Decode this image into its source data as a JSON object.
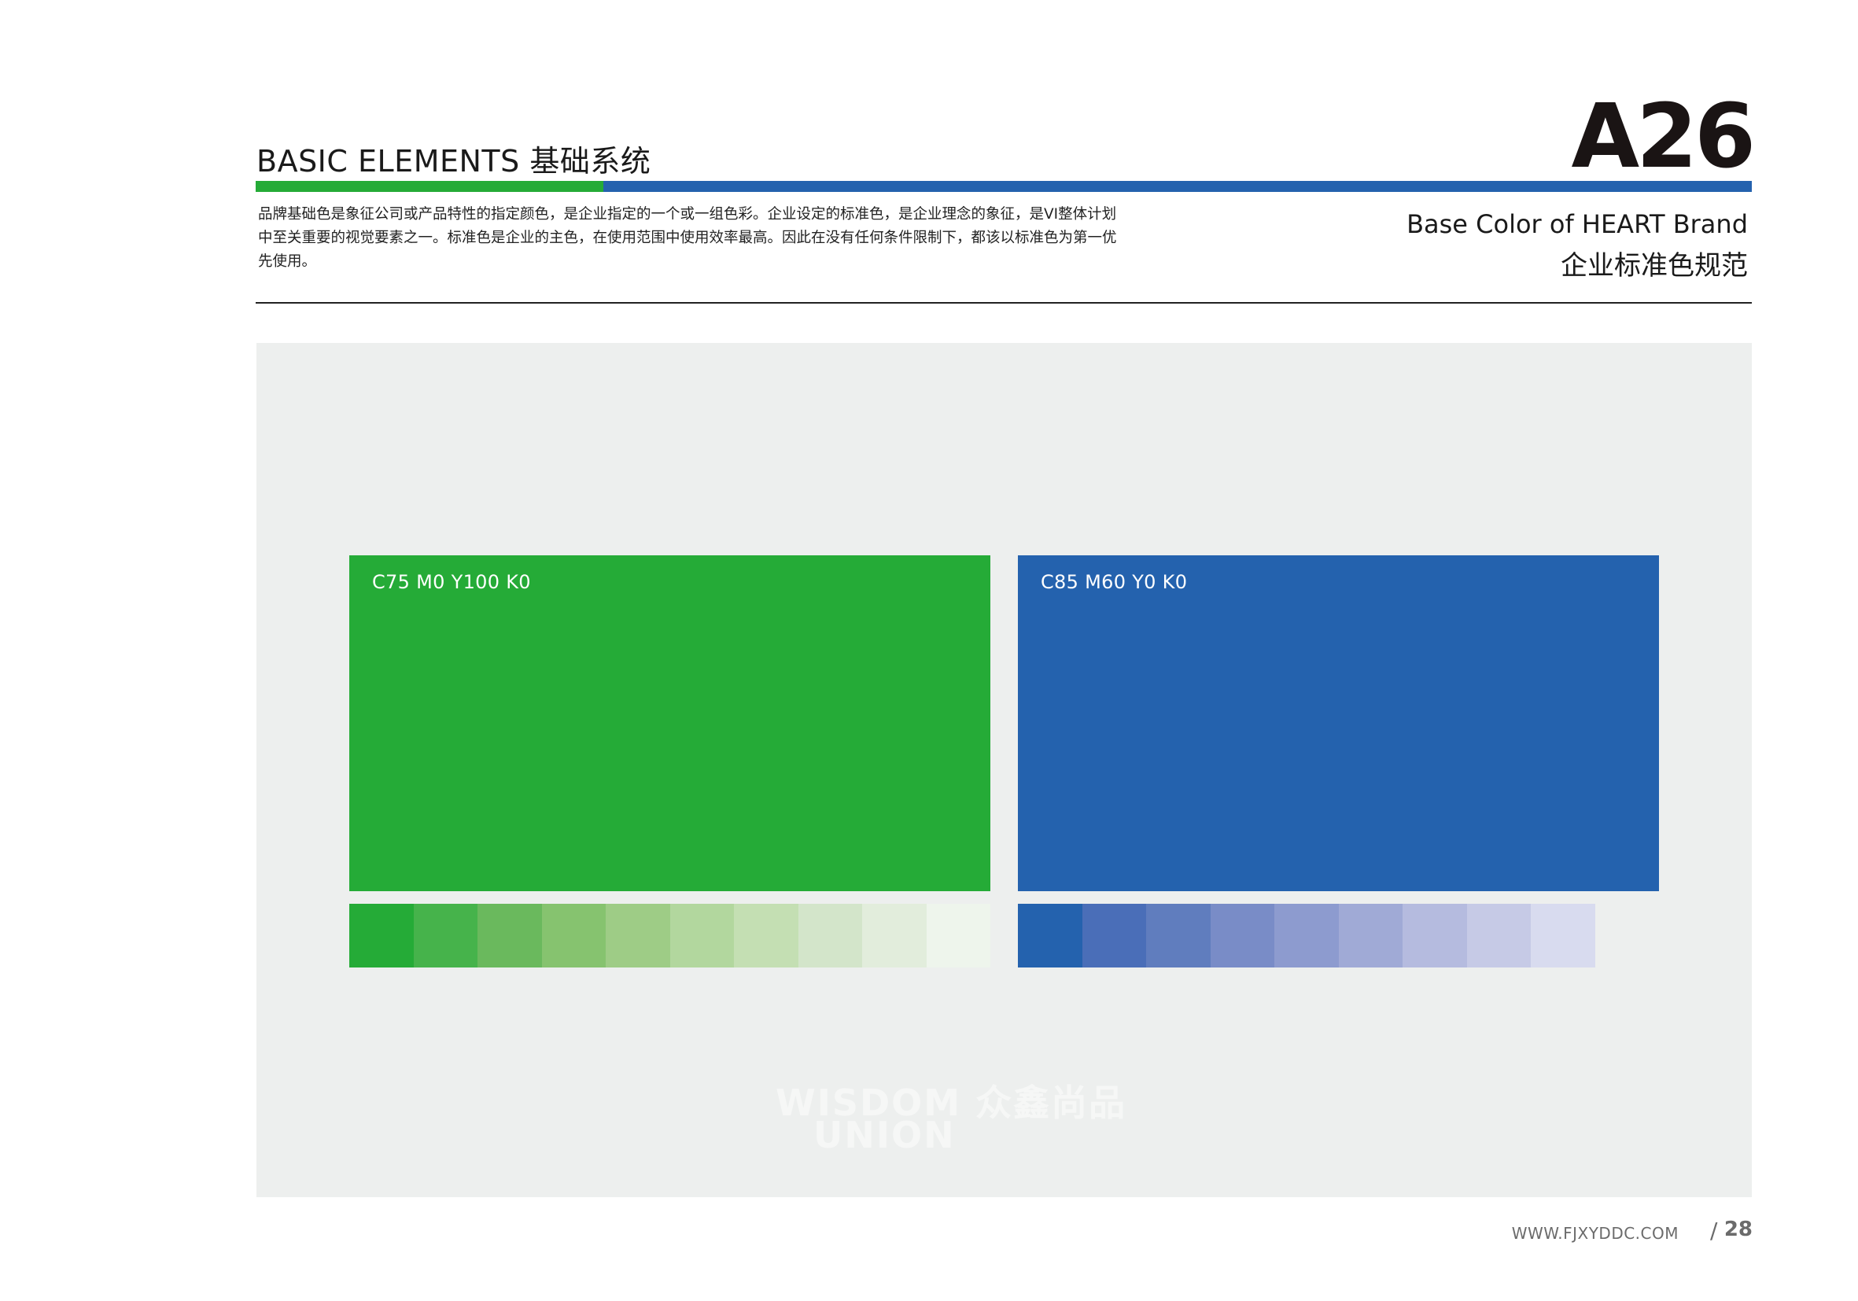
{
  "header": {
    "title": "BASIC ELEMENTS 基础系统",
    "page_code": "A26"
  },
  "accent_colors": {
    "green": "#25AB37",
    "blue": "#2462AE"
  },
  "intro_text": "品牌基础色是象征公司或产品特性的指定颜色，是企业指定的一个或一组色彩。企业设定的标准色，是企业理念的象征，是VI整体计划中至关重要的视觉要素之一。标准色是企业的主色，在使用范围中使用效率最高。因此在没有任何条件限制下，都该以标准色为第一优先使用。",
  "section": {
    "title_en": "Base Color of HEART Brand",
    "title_cn": "企业标准色规范"
  },
  "swatches": [
    {
      "label": "C75 M0 Y100 K0",
      "color": "#25AB37",
      "tints": [
        "#25AB37",
        "#46B34B",
        "#6AB95D",
        "#86C36F",
        "#9ECC86",
        "#B2D79E",
        "#C4DFB3",
        "#D3E5CA",
        "#E2EDDC",
        "#EEF5EC"
      ]
    },
    {
      "label": "C85 M60 Y0 K0",
      "color": "#2462AE",
      "tints": [
        "#2462AE",
        "#4A6EB8",
        "#607DBE",
        "#798CC7",
        "#8D9BCF",
        "#A0AAD6",
        "#B5BBDF",
        "#C6CAE6",
        "#D8DBEF"
      ]
    }
  ],
  "watermark": {
    "line1": "WISDOM 众鑫尚品",
    "line2": "UNION"
  },
  "footer": {
    "url": "WWW.FJXYDDC.COM",
    "slash": "/",
    "page_number": "28"
  }
}
